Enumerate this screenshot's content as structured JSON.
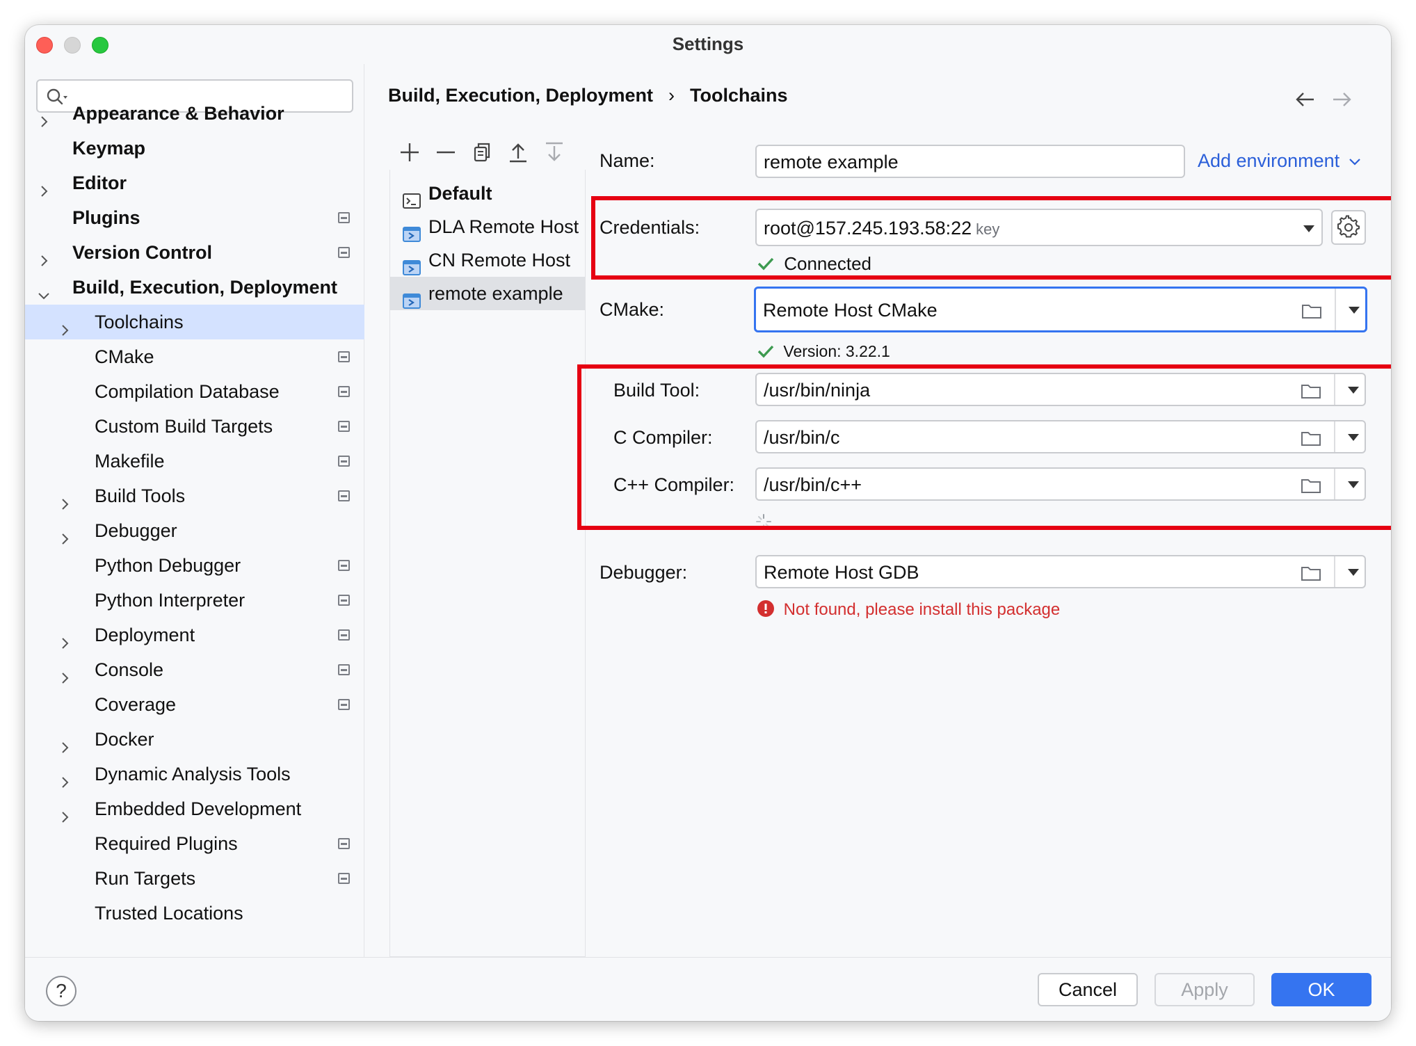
{
  "window": {
    "title": "Settings"
  },
  "search": {
    "placeholder": ""
  },
  "sidebar": {
    "items": [
      {
        "label": "Appearance & Behavior",
        "bold": true,
        "chevron": "right",
        "project": false
      },
      {
        "label": "Keymap",
        "bold": true,
        "chevron": "none",
        "project": false
      },
      {
        "label": "Editor",
        "bold": true,
        "chevron": "right",
        "project": false
      },
      {
        "label": "Plugins",
        "bold": true,
        "chevron": "none",
        "project": true
      },
      {
        "label": "Version Control",
        "bold": true,
        "chevron": "right",
        "project": true
      },
      {
        "label": "Build, Execution, Deployment",
        "bold": true,
        "chevron": "down",
        "project": false
      },
      {
        "label": "Toolchains",
        "bold": false,
        "chevron": "right",
        "project": false,
        "selected": true
      },
      {
        "label": "CMake",
        "bold": false,
        "chevron": "none",
        "project": true
      },
      {
        "label": "Compilation Database",
        "bold": false,
        "chevron": "none",
        "project": true
      },
      {
        "label": "Custom Build Targets",
        "bold": false,
        "chevron": "none",
        "project": true
      },
      {
        "label": "Makefile",
        "bold": false,
        "chevron": "none",
        "project": true
      },
      {
        "label": "Build Tools",
        "bold": false,
        "chevron": "right",
        "project": true
      },
      {
        "label": "Debugger",
        "bold": false,
        "chevron": "right",
        "project": false
      },
      {
        "label": "Python Debugger",
        "bold": false,
        "chevron": "none",
        "project": true
      },
      {
        "label": "Python Interpreter",
        "bold": false,
        "chevron": "none",
        "project": true
      },
      {
        "label": "Deployment",
        "bold": false,
        "chevron": "right",
        "project": true
      },
      {
        "label": "Console",
        "bold": false,
        "chevron": "right",
        "project": true
      },
      {
        "label": "Coverage",
        "bold": false,
        "chevron": "none",
        "project": true
      },
      {
        "label": "Docker",
        "bold": false,
        "chevron": "right",
        "project": false
      },
      {
        "label": "Dynamic Analysis Tools",
        "bold": false,
        "chevron": "right",
        "project": false
      },
      {
        "label": "Embedded Development",
        "bold": false,
        "chevron": "right",
        "project": false
      },
      {
        "label": "Required Plugins",
        "bold": false,
        "chevron": "none",
        "project": true
      },
      {
        "label": "Run Targets",
        "bold": false,
        "chevron": "none",
        "project": true
      },
      {
        "label": "Trusted Locations",
        "bold": false,
        "chevron": "none",
        "project": false
      }
    ]
  },
  "breadcrumb": {
    "parent": "Build, Execution, Deployment",
    "separator": "›",
    "current": "Toolchains"
  },
  "toolchains": {
    "items": [
      {
        "label": "Default",
        "icon": "terminal-icon",
        "bold": true
      },
      {
        "label": "DLA Remote Host",
        "icon": "remote-host-icon",
        "bold": false
      },
      {
        "label": "CN Remote Host",
        "icon": "remote-host-icon",
        "bold": false
      },
      {
        "label": "remote example",
        "icon": "remote-host-icon",
        "bold": false,
        "selected": true
      }
    ]
  },
  "form": {
    "name": {
      "label": "Name:",
      "value": "remote example"
    },
    "add_environment": "Add environment",
    "credentials": {
      "label": "Credentials:",
      "value": "root@157.245.193.58:22",
      "suffix": "key",
      "status": "Connected"
    },
    "cmake": {
      "label": "CMake:",
      "value": "Remote Host CMake",
      "status": "Version: 3.22.1"
    },
    "build_tool": {
      "label": "Build Tool:",
      "value": "/usr/bin/ninja"
    },
    "c_compiler": {
      "label": "C Compiler:",
      "value": "/usr/bin/c"
    },
    "cpp_compiler": {
      "label": "C++ Compiler:",
      "value": "/usr/bin/c++"
    },
    "debugger": {
      "label": "Debugger:",
      "value": "Remote Host GDB",
      "status": "Not found, please install this package"
    }
  },
  "footer": {
    "help": "?",
    "cancel": "Cancel",
    "apply": "Apply",
    "ok": "OK"
  },
  "colors": {
    "accent": "#3574f0",
    "highlight": "#e60012",
    "success": "#3d9a50",
    "error": "#d32f2f",
    "selection": "#d4e2ff"
  }
}
